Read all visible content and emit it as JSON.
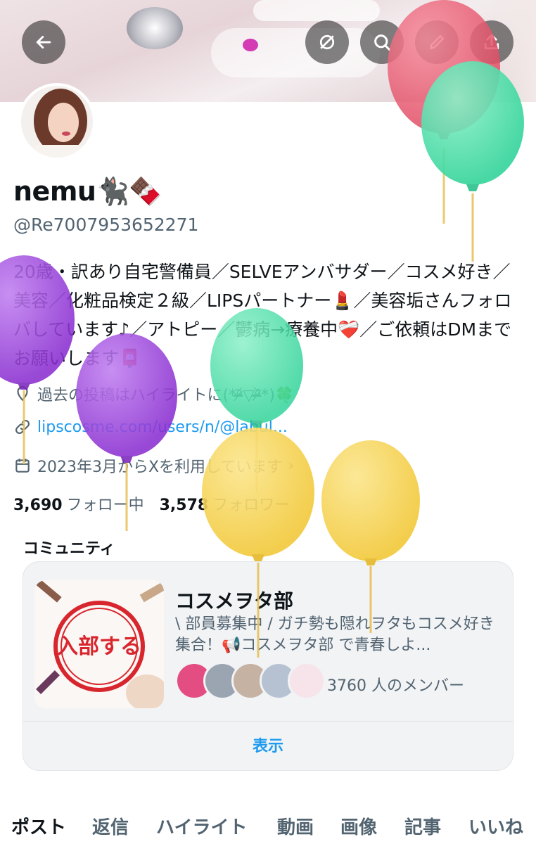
{
  "header": {
    "back_icon": "arrow-left-icon",
    "grok_icon": "slash-circle-icon",
    "search_icon": "search-icon",
    "edit_icon": "pencil-icon",
    "share_icon": "share-icon"
  },
  "profile": {
    "display_name": "nemu🐈‍⬛🍫",
    "handle": "@Re7007953652271",
    "bio": "20歳・訳あり自宅警備員／SELVEアンバサダー／コスメ好き／美容／化粧品検定２級／LIPSパートナー💄／美容垢さんフォロバしています♪／アトピー／鬱病→療養中❤️‍🩹／ご依頼はDMまでお願いします📮",
    "note": "過去の投稿はハイライトに(*ᵒ̴̶̷᷄▽ᵒ̴̶̷᷅*)🍀",
    "link": "lipscosme.com/users/n/@labul...",
    "joined": "2023年3月からXを利用しています",
    "following_count": "3,690",
    "following_label": "フォロー中",
    "followers_count": "3,578",
    "followers_label": "フォロワー"
  },
  "community": {
    "section_title": "コミュニティ",
    "name": "コスメヲタ部",
    "description": "\\ 部員募集中 / ガチ勢も隠れヲタもコスメ好き集合！📢コスメヲタ部 で青春しよ...",
    "members": "3760 人のメンバー",
    "show_label": "表示",
    "image_text": "入部する"
  },
  "tabs": [
    "ポスト",
    "返信",
    "ハイライト",
    "動画",
    "画像",
    "記事",
    "いいね"
  ],
  "colors": {
    "accent": "#1d9bf0",
    "balloon_red": "#e8506a",
    "balloon_green": "#3fd9a0",
    "balloon_purple": "#9b3fd6",
    "balloon_yellow": "#f3cf45"
  }
}
